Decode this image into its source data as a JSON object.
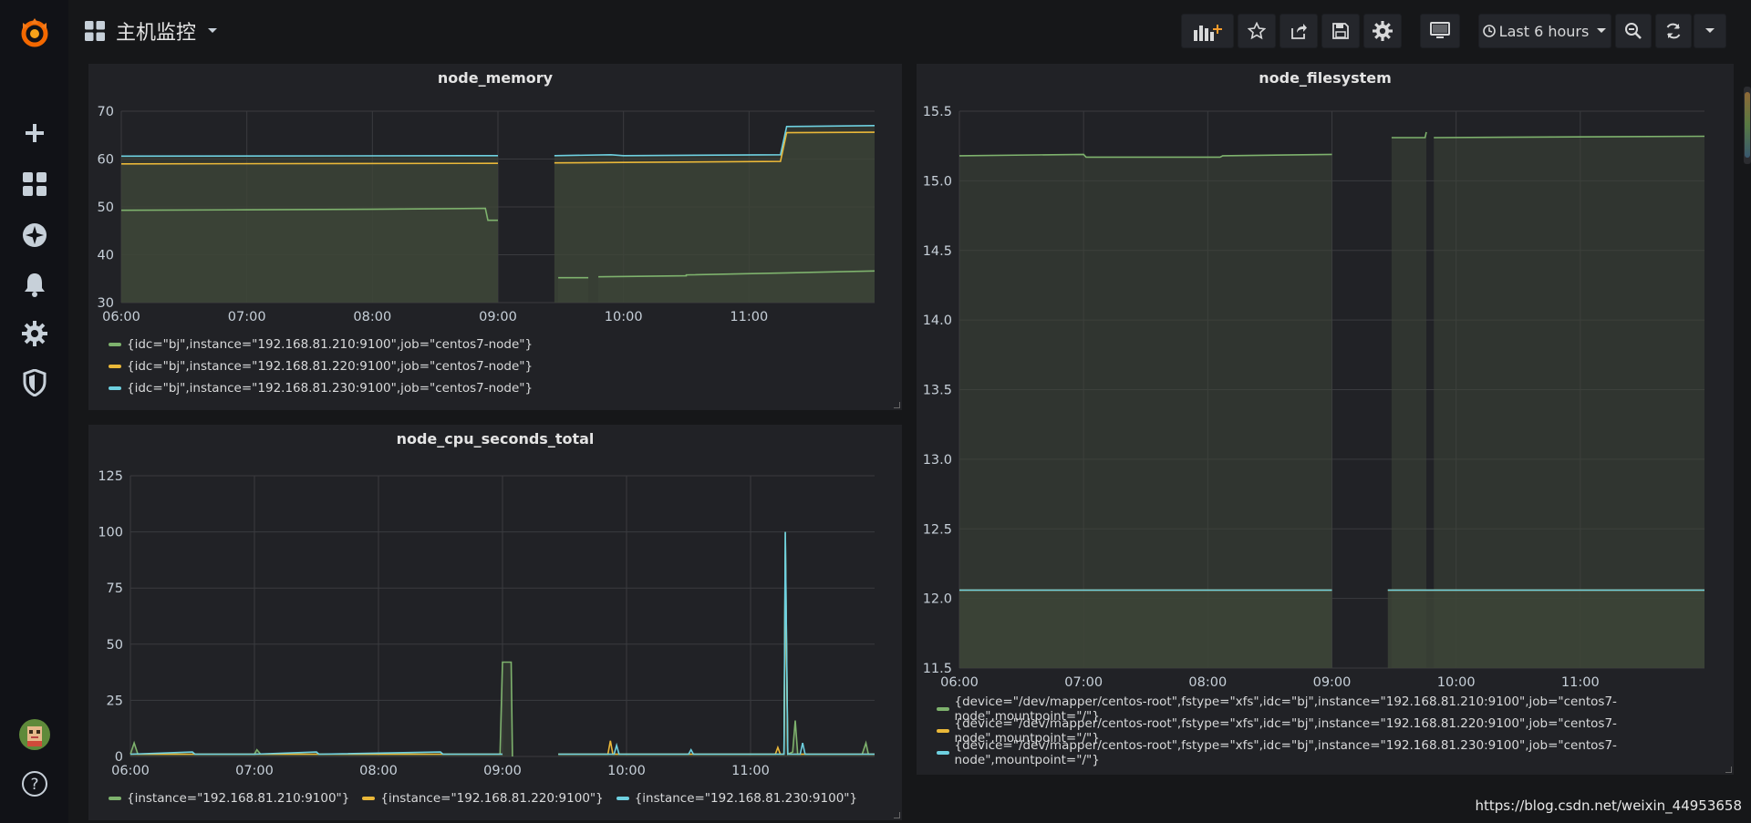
{
  "app": {
    "dashboard_title": "主机监控",
    "time_range_label": "Last 6 hours",
    "watermark": "https://blog.csdn.net/weixin_44953658"
  },
  "colors": {
    "green": "#7eb26d",
    "yellow": "#eab839",
    "cyan": "#6ed0e0",
    "grid": "#3a3b3f",
    "fill": "#3e4638"
  },
  "sidebar": {
    "items": [
      {
        "icon": "grafana-logo-icon"
      },
      {
        "icon": "plus-icon"
      },
      {
        "icon": "dashboards-icon"
      },
      {
        "icon": "explore-compass-icon"
      },
      {
        "icon": "bell-icon"
      },
      {
        "icon": "gear-icon"
      },
      {
        "icon": "shield-icon"
      },
      {
        "icon": "user-avatar-icon"
      },
      {
        "icon": "help-icon"
      }
    ]
  },
  "toolbar": {
    "buttons": [
      {
        "icon": "add-panel-icon"
      },
      {
        "icon": "star-icon"
      },
      {
        "icon": "share-icon"
      },
      {
        "icon": "save-icon"
      },
      {
        "icon": "settings-gear-icon"
      },
      {
        "icon": "tv-mode-icon"
      },
      {
        "icon": "clock-icon"
      },
      {
        "icon": "zoom-out-icon"
      },
      {
        "icon": "refresh-icon"
      },
      {
        "icon": "caret-down-icon"
      }
    ]
  },
  "panels": [
    {
      "title": "node_memory",
      "legend": [
        "{idc=\"bj\",instance=\"192.168.81.210:9100\",job=\"centos7-node\"}",
        "{idc=\"bj\",instance=\"192.168.81.220:9100\",job=\"centos7-node\"}",
        "{idc=\"bj\",instance=\"192.168.81.230:9100\",job=\"centos7-node\"}"
      ]
    },
    {
      "title": "node_cpu_seconds_total",
      "legend": [
        "{instance=\"192.168.81.210:9100\"}",
        "{instance=\"192.168.81.220:9100\"}",
        "{instance=\"192.168.81.230:9100\"}"
      ]
    },
    {
      "title": "node_filesystem",
      "legend": [
        "{device=\"/dev/mapper/centos-root\",fstype=\"xfs\",idc=\"bj\",instance=\"192.168.81.210:9100\",job=\"centos7-node\",mountpoint=\"/\"}",
        "{device=\"/dev/mapper/centos-root\",fstype=\"xfs\",idc=\"bj\",instance=\"192.168.81.220:9100\",job=\"centos7-node\",mountpoint=\"/\"}",
        "{device=\"/dev/mapper/centos-root\",fstype=\"xfs\",idc=\"bj\",instance=\"192.168.81.230:9100\",job=\"centos7-node\",mountpoint=\"/\"}"
      ]
    }
  ],
  "chart_data": [
    {
      "type": "area",
      "title": "node_memory",
      "x_ticks": [
        "06:00",
        "07:00",
        "08:00",
        "09:00",
        "10:00",
        "11:00"
      ],
      "xlim": [
        6.0,
        12.0
      ],
      "y_ticks": [
        30,
        40,
        50,
        60,
        70
      ],
      "ylim": [
        30,
        70
      ],
      "grid": true,
      "legend_position": "bottom",
      "series": [
        {
          "name": "{idc=\"bj\",instance=\"192.168.81.210:9100\",job=\"centos7-node\"}",
          "color": "#7eb26d",
          "segments": [
            [
              [
                6.0,
                49.3
              ],
              [
                7.0,
                49.4
              ],
              [
                8.0,
                49.5
              ],
              [
                8.9,
                49.7
              ],
              [
                8.92,
                47.2
              ],
              [
                9.0,
                47.2
              ]
            ],
            [
              [
                9.48,
                35.2
              ],
              [
                9.72,
                35.2
              ]
            ],
            [
              [
                9.8,
                35.4
              ],
              [
                10.5,
                35.6
              ],
              [
                10.5,
                35.8
              ],
              [
                11.3,
                36.2
              ],
              [
                12.0,
                36.6
              ]
            ]
          ]
        },
        {
          "name": "{idc=\"bj\",instance=\"192.168.81.220:9100\",job=\"centos7-node\"}",
          "color": "#eab839",
          "segments": [
            [
              [
                6.0,
                59.0
              ],
              [
                9.0,
                59.1
              ]
            ],
            [
              [
                9.45,
                59.2
              ],
              [
                10.0,
                59.3
              ],
              [
                11.25,
                59.5
              ],
              [
                11.3,
                65.5
              ],
              [
                12.0,
                65.6
              ]
            ]
          ]
        },
        {
          "name": "{idc=\"bj\",instance=\"192.168.81.230:9100\",job=\"centos7-node\"}",
          "color": "#6ed0e0",
          "segments": [
            [
              [
                6.0,
                60.6
              ],
              [
                9.0,
                60.7
              ]
            ],
            [
              [
                9.45,
                60.7
              ],
              [
                9.9,
                60.9
              ],
              [
                10.0,
                60.7
              ],
              [
                11.25,
                60.9
              ],
              [
                11.3,
                66.8
              ],
              [
                12.0,
                67.0
              ]
            ]
          ]
        }
      ]
    },
    {
      "type": "line",
      "title": "node_cpu_seconds_total",
      "x_ticks": [
        "06:00",
        "07:00",
        "08:00",
        "09:00",
        "10:00",
        "11:00"
      ],
      "xlim": [
        6.0,
        12.0
      ],
      "y_ticks": [
        0,
        25,
        50,
        75,
        100,
        125
      ],
      "ylim": [
        0,
        125
      ],
      "grid": true,
      "legend_position": "bottom",
      "series": [
        {
          "name": "{instance=\"192.168.81.210:9100\"}",
          "color": "#7eb26d",
          "segments": [
            [
              [
                6.0,
                1
              ],
              [
                6.03,
                6
              ],
              [
                6.06,
                1
              ],
              [
                7.0,
                1
              ],
              [
                7.02,
                3
              ],
              [
                7.05,
                1
              ],
              [
                8.0,
                1
              ],
              [
                8.5,
                1
              ],
              [
                8.98,
                1
              ],
              [
                9.0,
                42
              ],
              [
                9.07,
                42
              ],
              [
                9.08,
                0
              ]
            ],
            [
              [
                9.45,
                1
              ],
              [
                10.0,
                1
              ],
              [
                11.0,
                1
              ],
              [
                11.27,
                1
              ],
              [
                11.28,
                100
              ],
              [
                11.3,
                1
              ],
              [
                11.34,
                2
              ],
              [
                11.36,
                16
              ],
              [
                11.38,
                1
              ],
              [
                11.9,
                1
              ],
              [
                11.93,
                6
              ],
              [
                11.95,
                1
              ],
              [
                12.0,
                1
              ]
            ]
          ]
        },
        {
          "name": "{instance=\"192.168.81.220:9100\"}",
          "color": "#eab839",
          "segments": [
            [
              [
                6.0,
                1
              ],
              [
                9.0,
                1
              ]
            ],
            [
              [
                9.45,
                1
              ],
              [
                9.85,
                1
              ],
              [
                9.87,
                7
              ],
              [
                9.89,
                1
              ],
              [
                11.2,
                1
              ],
              [
                11.22,
                4
              ],
              [
                11.24,
                1
              ],
              [
                11.27,
                1
              ],
              [
                11.28,
                90
              ],
              [
                11.3,
                1
              ],
              [
                12.0,
                1
              ]
            ]
          ]
        },
        {
          "name": "{instance=\"192.168.81.230:9100\"}",
          "color": "#6ed0e0",
          "segments": [
            [
              [
                6.0,
                1
              ],
              [
                6.5,
                2
              ],
              [
                6.52,
                1
              ],
              [
                7.0,
                1
              ],
              [
                7.5,
                2
              ],
              [
                7.52,
                1
              ],
              [
                8.5,
                2
              ],
              [
                8.52,
                1
              ],
              [
                9.0,
                1
              ]
            ],
            [
              [
                9.45,
                1
              ],
              [
                9.9,
                1
              ],
              [
                9.92,
                5
              ],
              [
                9.94,
                1
              ],
              [
                10.5,
                1
              ],
              [
                10.52,
                3
              ],
              [
                10.54,
                1
              ],
              [
                11.27,
                1
              ],
              [
                11.28,
                100
              ],
              [
                11.3,
                1
              ],
              [
                11.4,
                1
              ],
              [
                11.42,
                6
              ],
              [
                11.44,
                1
              ],
              [
                12.0,
                1
              ]
            ]
          ]
        }
      ]
    },
    {
      "type": "area",
      "title": "node_filesystem",
      "x_ticks": [
        "06:00",
        "07:00",
        "08:00",
        "09:00",
        "10:00",
        "11:00"
      ],
      "xlim": [
        6.0,
        12.0
      ],
      "y_ticks": [
        11.5,
        12.0,
        12.5,
        13.0,
        13.5,
        14.0,
        14.5,
        15.0,
        15.5
      ],
      "ylim": [
        11.5,
        15.5
      ],
      "grid": true,
      "legend_position": "bottom",
      "series": [
        {
          "name": "{device=\"/dev/mapper/centos-root\",fstype=\"xfs\",idc=\"bj\",instance=\"192.168.81.210:9100\",job=\"centos7-node\",mountpoint=\"/\"}",
          "color": "#7eb26d",
          "segments": [
            [
              [
                6.0,
                15.18
              ],
              [
                7.0,
                15.19
              ],
              [
                7.02,
                15.17
              ],
              [
                8.1,
                15.17
              ],
              [
                8.12,
                15.18
              ],
              [
                9.0,
                15.19
              ]
            ],
            [
              [
                9.48,
                15.31
              ],
              [
                9.75,
                15.31
              ],
              [
                9.76,
                15.35
              ]
            ],
            [
              [
                9.82,
                15.31
              ],
              [
                12.0,
                15.32
              ]
            ]
          ]
        },
        {
          "name": "{device=\"/dev/mapper/centos-root\",fstype=\"xfs\",idc=\"bj\",instance=\"192.168.81.220:9100\",job=\"centos7-node\",mountpoint=\"/\"}",
          "color": "#eab839",
          "segments": [
            [
              [
                6.0,
                12.06
              ],
              [
                9.0,
                12.06
              ]
            ],
            [
              [
                9.45,
                12.06
              ],
              [
                12.0,
                12.06
              ]
            ]
          ]
        },
        {
          "name": "{device=\"/dev/mapper/centos-root\",fstype=\"xfs\",idc=\"bj\",instance=\"192.168.81.230:9100\",job=\"centos7-node\",mountpoint=\"/\"}",
          "color": "#6ed0e0",
          "segments": [
            [
              [
                6.0,
                12.06
              ],
              [
                9.0,
                12.06
              ]
            ],
            [
              [
                9.45,
                12.06
              ],
              [
                12.0,
                12.06
              ]
            ]
          ]
        }
      ]
    }
  ]
}
